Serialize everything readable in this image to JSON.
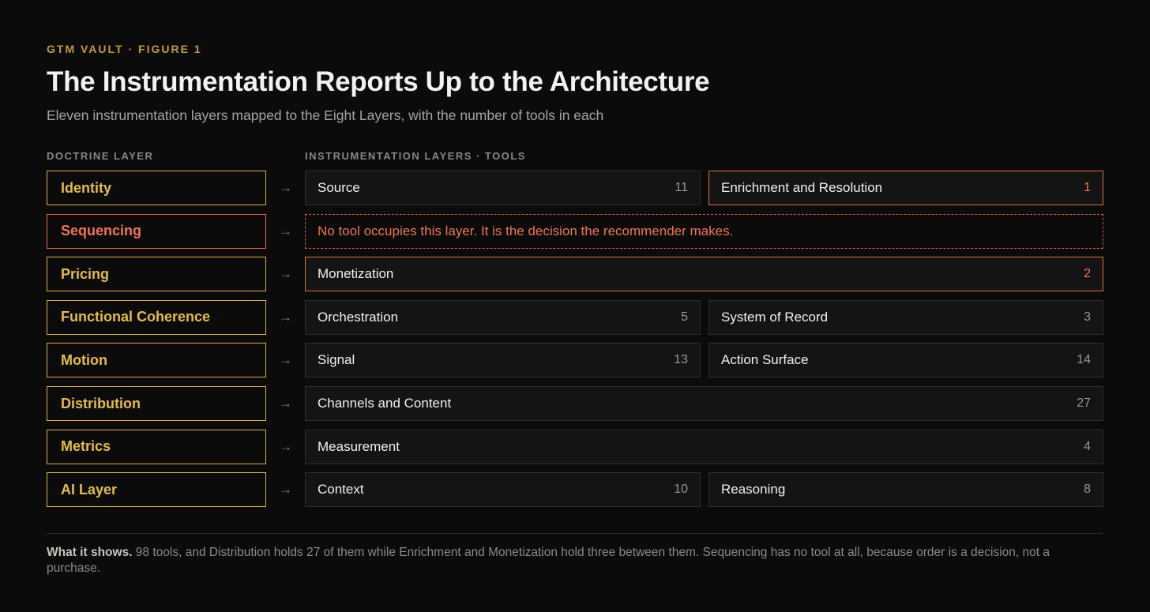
{
  "header": {
    "eyebrow": "GTM VAULT · FIGURE 1",
    "title": "The Instrumentation Reports Up to the Architecture",
    "subtitle": "Eleven instrumentation layers mapped to the Eight Layers, with the number of tools in each"
  },
  "columns": {
    "left": "DOCTRINE LAYER",
    "right": "INSTRUMENTATION LAYERS · TOOLS"
  },
  "arrow_glyph": "→",
  "colors": {
    "background": "#0b0b0b",
    "gold": "#e6bc45",
    "orange": "#ef7452",
    "box": "#141414"
  },
  "rows": [
    {
      "doctrine": "Identity",
      "highlight": false,
      "tools": [
        {
          "name": "Source",
          "count": "11",
          "highlight": false
        },
        {
          "name": "Enrichment and Resolution",
          "count": "1",
          "highlight": true
        }
      ]
    },
    {
      "doctrine": "Sequencing",
      "highlight": true,
      "empty_note": "No tool occupies this layer. It is the decision the recommender makes."
    },
    {
      "doctrine": "Pricing",
      "highlight": false,
      "tools": [
        {
          "name": "Monetization",
          "count": "2",
          "highlight": true
        }
      ]
    },
    {
      "doctrine": "Functional Coherence",
      "highlight": false,
      "tools": [
        {
          "name": "Orchestration",
          "count": "5",
          "highlight": false
        },
        {
          "name": "System of Record",
          "count": "3",
          "highlight": false
        }
      ]
    },
    {
      "doctrine": "Motion",
      "highlight": false,
      "tools": [
        {
          "name": "Signal",
          "count": "13",
          "highlight": false
        },
        {
          "name": "Action Surface",
          "count": "14",
          "highlight": false
        }
      ]
    },
    {
      "doctrine": "Distribution",
      "highlight": false,
      "tools": [
        {
          "name": "Channels and Content",
          "count": "27",
          "highlight": false
        }
      ]
    },
    {
      "doctrine": "Metrics",
      "highlight": false,
      "tools": [
        {
          "name": "Measurement",
          "count": "4",
          "highlight": false
        }
      ]
    },
    {
      "doctrine": "AI Layer",
      "highlight": false,
      "tools": [
        {
          "name": "Context",
          "count": "10",
          "highlight": false
        },
        {
          "name": "Reasoning",
          "count": "8",
          "highlight": false
        }
      ]
    }
  ],
  "footnote": {
    "lead": "What it shows.",
    "text": " 98 tools, and Distribution holds 27 of them while Enrichment and Monetization hold three between them. Sequencing has no tool at all, because order is a decision, not a purchase."
  }
}
